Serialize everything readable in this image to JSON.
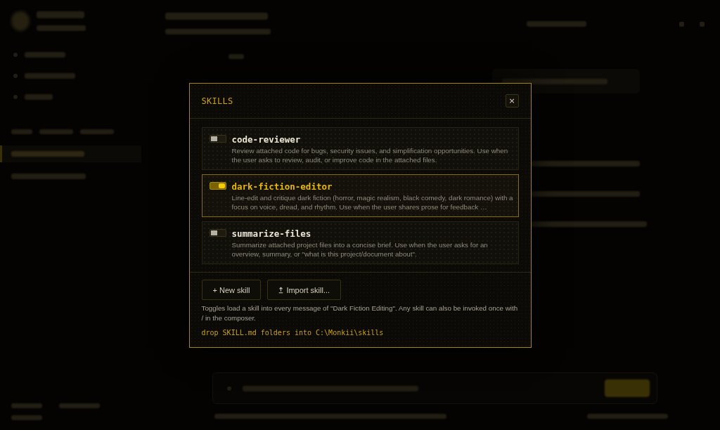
{
  "modal": {
    "title": "SKILLS",
    "close_label": "×",
    "skills": [
      {
        "name": "code-reviewer",
        "description": "Review attached code for bugs, security issues, and simplification opportunities. Use when the user asks to review, audit, or improve code in the attached files.",
        "on": false
      },
      {
        "name": "dark-fiction-editor",
        "description": "Line-edit and critique dark fiction (horror, magic realism, black comedy, dark romance) with a focus on voice, dread, and rhythm. Use when the user shares prose for feedback …",
        "on": true
      },
      {
        "name": "summarize-files",
        "description": "Summarize attached project files into a concise brief. Use when the user asks for an overview, summary, or \"what is this project/document about\".",
        "on": false
      }
    ],
    "buttons": [
      {
        "label": "+ New skill",
        "kind": "new"
      },
      {
        "label": "Import skill...",
        "kind": "import"
      }
    ],
    "note": "Toggles load a skill into every message of \"Dark Fiction Editing\". Any skill can also be invoked once with / in the composer.",
    "path_hint": "drop SKILL.md folders into C:\\Monkii\\skills"
  }
}
